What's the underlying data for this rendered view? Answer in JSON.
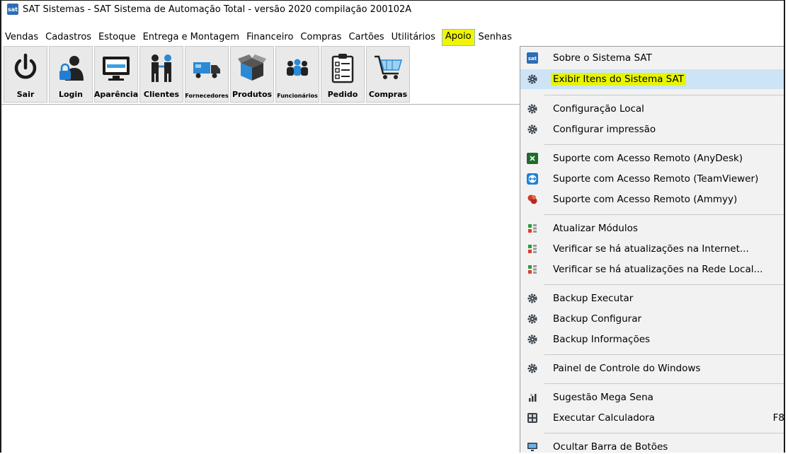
{
  "window": {
    "title": "SAT Sistemas - SAT Sistema de Automação Total - versão 2020 compilação 200102A",
    "icon_text": "sat"
  },
  "menubar": [
    {
      "label": "Vendas"
    },
    {
      "label": "Cadastros"
    },
    {
      "label": "Estoque"
    },
    {
      "label": "Entrega e Montagem"
    },
    {
      "label": "Financeiro"
    },
    {
      "label": "Compras"
    },
    {
      "label": "Cartões"
    },
    {
      "label": "Utilitários"
    },
    {
      "label": "Apoio"
    },
    {
      "label": "Senhas"
    }
  ],
  "toolbar": [
    {
      "label": "Sair",
      "icon": "power-icon"
    },
    {
      "label": "Login",
      "icon": "user-lock-icon"
    },
    {
      "label": "Aparência",
      "icon": "monitor-icon"
    },
    {
      "label": "Clientes",
      "icon": "people-icon"
    },
    {
      "label": "Fornecedores",
      "icon": "truck-icon"
    },
    {
      "label": "Produtos",
      "icon": "box-icon"
    },
    {
      "label": "Funcionários",
      "icon": "group-icon"
    },
    {
      "label": "Pedido",
      "icon": "clipboard-icon"
    },
    {
      "label": "Compras",
      "icon": "cart-icon"
    }
  ],
  "apoio_menu": {
    "items": [
      {
        "label": "Sobre o Sistema SAT",
        "icon": "sat-icon"
      },
      {
        "label": "Exibir Itens do Sistema SAT",
        "icon": "gear-icon",
        "highlighted": true
      },
      {
        "label": "Configuração Local",
        "icon": "gear-icon"
      },
      {
        "label": "Configurar impressão",
        "icon": "gear-icon"
      },
      {
        "label": "Suporte com Acesso Remoto (AnyDesk)",
        "icon": "anydesk-icon"
      },
      {
        "label": "Suporte com Acesso Remoto (TeamViewer)",
        "icon": "teamviewer-icon"
      },
      {
        "label": "Suporte com Acesso Remoto (Ammyy)",
        "icon": "ammyy-icon"
      },
      {
        "label": "Atualizar Módulos",
        "icon": "update-icon"
      },
      {
        "label": "Verificar se há atualizações na Internet...",
        "icon": "update-icon"
      },
      {
        "label": "Verificar se há atualizações na Rede Local...",
        "icon": "update-icon"
      },
      {
        "label": "Backup Executar",
        "icon": "gear-icon"
      },
      {
        "label": "Backup Configurar",
        "icon": "gear-icon"
      },
      {
        "label": "Backup Informações",
        "icon": "gear-icon"
      },
      {
        "label": "Painel de Controle do Windows",
        "icon": "gear-icon"
      },
      {
        "label": "Sugestão Mega Sena",
        "icon": "chart-icon"
      },
      {
        "label": "Executar Calculadora",
        "icon": "calculator-icon",
        "shortcut": "F8"
      },
      {
        "label": "Ocultar Barra de Botões",
        "icon": "screen-icon"
      }
    ]
  },
  "colors": {
    "highlight_yellow": "#e8f500",
    "menu_hover": "#cde4f7",
    "toolbar_button": "#e9e9e9"
  }
}
